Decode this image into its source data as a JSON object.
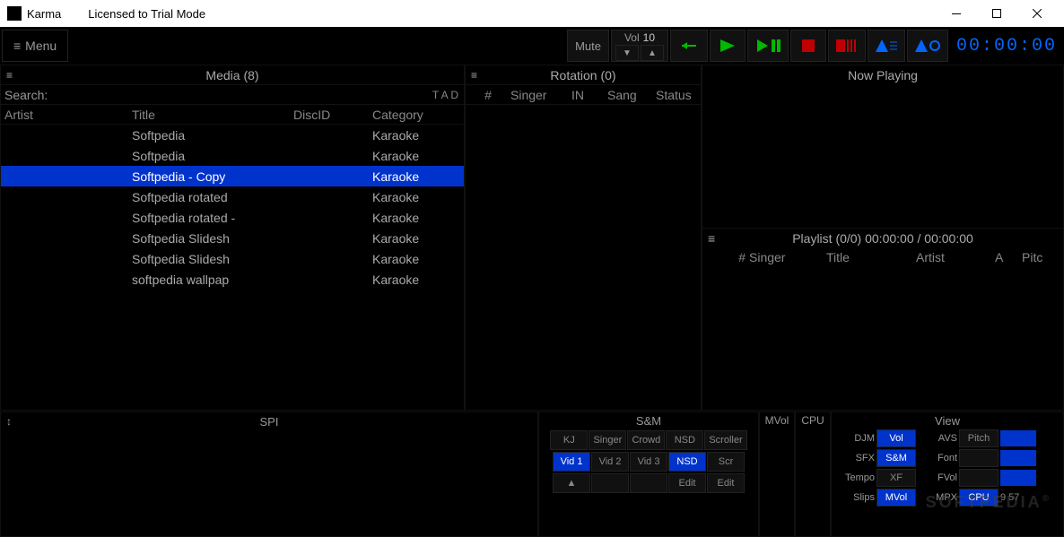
{
  "window": {
    "title": "Karma",
    "license": "Licensed to Trial Mode"
  },
  "menu_label": "Menu",
  "mute_label": "Mute",
  "volume": {
    "label": "Vol",
    "value": "10"
  },
  "timecode": "00:00:00",
  "panels": {
    "media": {
      "title": "Media (8)",
      "search_label": "Search:",
      "tad": "T A D",
      "columns": {
        "artist": "Artist",
        "title": "Title",
        "discid": "DiscID",
        "category": "Category"
      },
      "rows": [
        {
          "artist": "",
          "title": "Softpedia",
          "discid": "",
          "category": "Karaoke",
          "selected": false
        },
        {
          "artist": "",
          "title": "Softpedia",
          "discid": "",
          "category": "Karaoke",
          "selected": false
        },
        {
          "artist": "",
          "title": "Softpedia - Copy",
          "discid": "",
          "category": "Karaoke",
          "selected": true
        },
        {
          "artist": "",
          "title": "Softpedia rotated",
          "discid": "",
          "category": "Karaoke",
          "selected": false
        },
        {
          "artist": "",
          "title": "Softpedia rotated -",
          "discid": "",
          "category": "Karaoke",
          "selected": false
        },
        {
          "artist": "",
          "title": "Softpedia Slidesh",
          "discid": "",
          "category": "Karaoke",
          "selected": false
        },
        {
          "artist": "",
          "title": "Softpedia Slidesh",
          "discid": "",
          "category": "Karaoke",
          "selected": false
        },
        {
          "artist": "",
          "title": "softpedia wallpap",
          "discid": "",
          "category": "Karaoke",
          "selected": false
        }
      ]
    },
    "rotation": {
      "title": "Rotation (0)",
      "columns": {
        "num": "#",
        "singer": "Singer",
        "in": "IN",
        "sang": "Sang",
        "status": "Status"
      }
    },
    "now_playing": {
      "title": "Now Playing"
    },
    "playlist": {
      "title": "Playlist (0/0)  00:00:00 / 00:00:00",
      "columns": {
        "num": "#",
        "singer": "Singer",
        "title": "Title",
        "artist": "Artist",
        "a": "A",
        "pitc": "Pitc"
      }
    }
  },
  "spi_label": "SPI",
  "sm": {
    "title": "S&M",
    "row1": [
      "KJ",
      "Singer",
      "Crowd",
      "NSD",
      "Scroller"
    ],
    "row2": [
      {
        "label": "Vid 1",
        "active": true
      },
      {
        "label": "Vid 2",
        "active": false
      },
      {
        "label": "Vid 3",
        "active": false
      },
      {
        "label": "NSD",
        "active": true
      },
      {
        "label": "Scr",
        "active": false
      }
    ],
    "row3": [
      {
        "label": "▲",
        "active": false
      },
      {
        "label": "",
        "active": false
      },
      {
        "label": "",
        "active": false
      },
      {
        "label": "Edit",
        "active": false
      },
      {
        "label": "Edit",
        "active": false
      }
    ]
  },
  "mvol_label": "MVol",
  "cpu_label": "CPU",
  "view": {
    "title": "View",
    "rows": [
      {
        "l1": "DJM",
        "b1": "Vol",
        "a1": true,
        "l2": "AVS",
        "b2": "Pitch"
      },
      {
        "l1": "SFX",
        "b1": "S&M",
        "a1": true,
        "l2": "Font",
        "b2": ""
      },
      {
        "l1": "Tempo",
        "b1": "XF",
        "a1": false,
        "l2": "FVol",
        "b2": ""
      },
      {
        "l1": "Slips",
        "b1": "MVol",
        "a1": true,
        "l2": "MPX",
        "b2": "CPU",
        "a2": true,
        "time": "9 57"
      }
    ]
  },
  "watermark": "SOFTPEDIA"
}
